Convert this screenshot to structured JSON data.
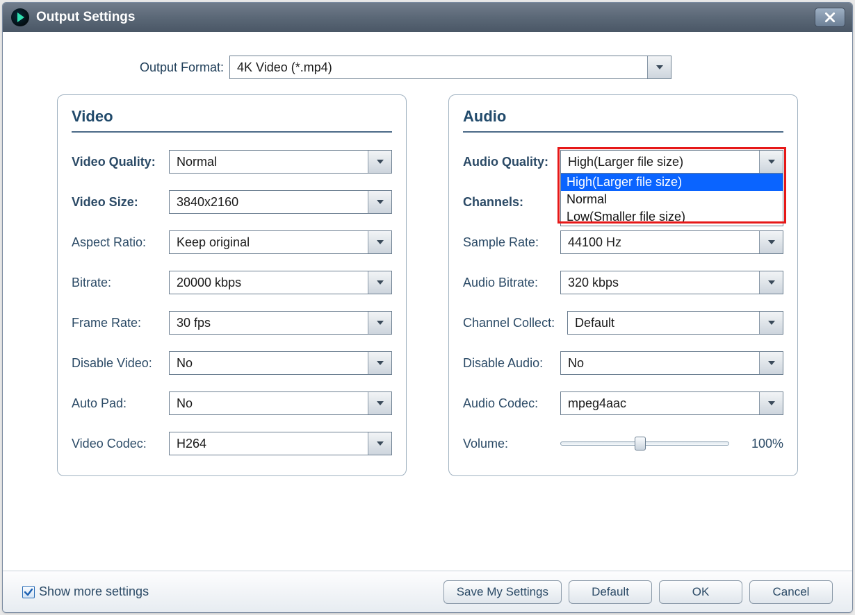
{
  "window": {
    "title": "Output Settings"
  },
  "format": {
    "label": "Output Format:",
    "value": "4K Video (*.mp4)"
  },
  "video": {
    "title": "Video",
    "quality": {
      "label": "Video Quality:",
      "value": "Normal"
    },
    "size": {
      "label": "Video Size:",
      "value": "3840x2160"
    },
    "aspect": {
      "label": "Aspect Ratio:",
      "value": "Keep original"
    },
    "bitrate": {
      "label": "Bitrate:",
      "value": "20000 kbps"
    },
    "fps": {
      "label": "Frame Rate:",
      "value": "30 fps"
    },
    "disable": {
      "label": "Disable Video:",
      "value": "No"
    },
    "autopad": {
      "label": "Auto Pad:",
      "value": "No"
    },
    "codec": {
      "label": "Video Codec:",
      "value": "H264"
    }
  },
  "audio": {
    "title": "Audio",
    "quality": {
      "label": "Audio Quality:",
      "value": "High(Larger file size)",
      "options": [
        "High(Larger file size)",
        "Normal",
        "Low(Smaller file size)"
      ]
    },
    "channels": {
      "label": "Channels:"
    },
    "sample": {
      "label": "Sample Rate:",
      "value": "44100 Hz"
    },
    "bitrate": {
      "label": "Audio Bitrate:",
      "value": "320 kbps"
    },
    "collect": {
      "label": "Channel Collect:",
      "value": "Default"
    },
    "disable": {
      "label": "Disable Audio:",
      "value": "No"
    },
    "codec": {
      "label": "Audio Codec:",
      "value": "mpeg4aac"
    },
    "volume": {
      "label": "Volume:",
      "value": "100%"
    }
  },
  "footer": {
    "show_more": "Show more settings",
    "save": "Save My Settings",
    "default": "Default",
    "ok": "OK",
    "cancel": "Cancel"
  }
}
